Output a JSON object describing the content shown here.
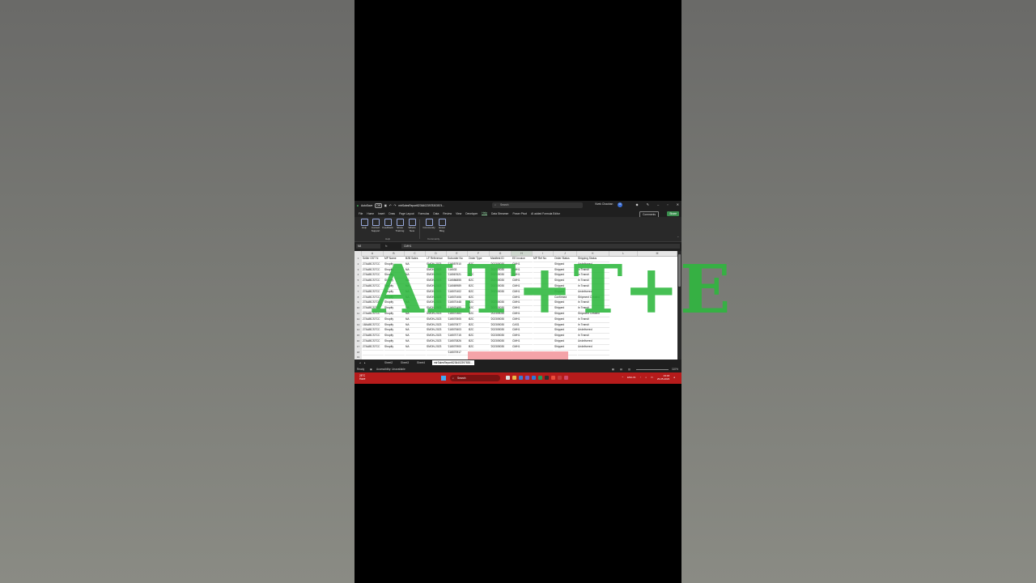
{
  "titlebar": {
    "autosave_label": "AutoSave",
    "autosave_state": "Off",
    "filename": "mtrSalesReport82364023978303574...",
    "search_placeholder": "Search",
    "user_name": "Vivek Chauhan",
    "user_initials": "VC"
  },
  "menu": {
    "items": [
      "File",
      "Home",
      "Insert",
      "Draw",
      "Page Layout",
      "Formulas",
      "Data",
      "Review",
      "View",
      "Developer",
      "Help",
      "Data Streamer",
      "Power Pivot",
      "AI added Formula Editor"
    ],
    "active": "Help",
    "comments_label": "Comments",
    "share_label": "Share"
  },
  "ribbon": {
    "buttons": [
      {
        "label": "Help",
        "icon": "help-icon"
      },
      {
        "label": "Contact Support",
        "icon": "support-icon"
      },
      {
        "label": "Feedback",
        "icon": "feedback-icon"
      },
      {
        "label": "Show Training",
        "icon": "training-icon"
      },
      {
        "label": "What's New",
        "icon": "whats-new-icon"
      },
      {
        "label": "Community",
        "icon": "community-icon"
      },
      {
        "label": "Excel Blog",
        "icon": "blog-icon"
      }
    ],
    "groups": [
      "Help",
      "Community"
    ]
  },
  "formula_bar": {
    "name_box": "N8",
    "fx": "fx",
    "content": "CMH1"
  },
  "sheet": {
    "columns": [
      "A",
      "B",
      "C",
      "D",
      "E",
      "F",
      "G",
      "H",
      "I",
      "J",
      "K",
      "L",
      "M"
    ],
    "rows": [
      "1",
      "2",
      "3",
      "4",
      "5",
      "6",
      "7",
      "8",
      "9",
      "10",
      "11",
      "12",
      "13",
      "14",
      "15",
      "16",
      "17",
      "18",
      "19"
    ],
    "headers": [
      "Seller GST N",
      "MP Name",
      "B2B Sales",
      "LF Reference",
      "Suborder No",
      "Order Type",
      "Manifest ID",
      "EE Invoice",
      "MP Ref No",
      "Order Status",
      "Shipping Status"
    ],
    "data": [
      [
        "27AABCS7CC",
        "Shopify",
        "NA",
        "SMON-2023",
        "'116557910",
        "B2C",
        "'202305030",
        "CMH1",
        "",
        "Shipped",
        "Undelivered"
      ],
      [
        "27AABCS7CC",
        "Shopify",
        "NA",
        "SMON-2023",
        "'116533",
        "",
        "'202305030",
        "CMH1",
        "",
        "Shipped",
        "In Transit"
      ],
      [
        "27AABCS7CC",
        "Shopify",
        "NA",
        "SMON-2023",
        "'116567621",
        "B2C",
        "'202305030",
        "CMH1",
        "",
        "Shipped",
        "In Transit"
      ],
      [
        "27AABCS7CC",
        "Shopify",
        "NA",
        "SMON-2023",
        "'116586855",
        "B2C",
        "'202305030",
        "CMH1",
        "",
        "Shipped",
        "In Transit"
      ],
      [
        "27AABCS7CC",
        "Shopify",
        "NA",
        "SMON-2023",
        "'116569989",
        "B2C",
        "'202305030",
        "CMH1",
        "",
        "Shipped",
        "In Transit"
      ],
      [
        "27AABCS7CC",
        "Shopify",
        "NA",
        "SMON-2023",
        "'116570402",
        "B2C",
        "'202305030",
        "CMH1",
        "",
        "Shipped",
        "Undelivered"
      ],
      [
        "27AABCS7CC",
        "Shopify",
        "NA",
        "SMON-2023",
        "'116570406",
        "B2C",
        "",
        "CMH1",
        "",
        "Confirmed",
        "Shipment Created"
      ],
      [
        "27AABCS7CC",
        "Shopify",
        "NA",
        "SMON-2023",
        "'116570448",
        "B2C",
        "'202305030",
        "CMH1",
        "",
        "Shipped",
        "In Transit"
      ],
      [
        "27AABCS7CC",
        "Shopify",
        "NA",
        "SMON-2023",
        "'116570455",
        "B2C",
        "'202305030",
        "CMH1",
        "",
        "Shipped",
        "In Transit"
      ],
      [
        "27AABCS7CC",
        "Shopify",
        "NA",
        "SMON-2023",
        "'116570483",
        "B2C",
        "'202305030",
        "CMH1",
        "",
        "Shipped",
        "Shipment Created"
      ],
      [
        "27AABCS7CC",
        "Shopify",
        "NA",
        "SMON-2023",
        "'116570505",
        "B2C",
        "'202305030",
        "CMH1",
        "",
        "Shipped",
        "In Transit"
      ],
      [
        "18AABCS7CC",
        "Shopify",
        "NA",
        "SMON-2023",
        "'116570577",
        "B2C",
        "'202305030",
        "CAS1",
        "",
        "Shipped",
        "In Transit"
      ],
      [
        "27AABCS7CC",
        "Shopify",
        "NA",
        "SMON-2023",
        "'116570603",
        "B2C",
        "'202305030",
        "CMH1",
        "",
        "Shipped",
        "Undelivered"
      ],
      [
        "27AABCS7CC",
        "Shopify",
        "NA",
        "SMON-2023",
        "'116570715",
        "B2C",
        "'202305030",
        "CMH1",
        "",
        "Shipped",
        "In Transit"
      ],
      [
        "27AABCS7CC",
        "Shopify",
        "NA",
        "SMON-2023",
        "'116570826",
        "B2C",
        "'202305030",
        "CMH1",
        "",
        "Shipped",
        "Undelivered"
      ],
      [
        "27AABCS7CC",
        "Shopify",
        "NA",
        "SMON-2023",
        "'116570900",
        "B2C",
        "'202305030",
        "CMH1",
        "",
        "Shipped",
        "Undelivered"
      ],
      [
        "",
        "",
        "",
        "",
        "'116570917",
        "",
        "",
        "",
        "",
        "",
        ""
      ]
    ]
  },
  "sheet_tabs": {
    "tabs": [
      "Sheet2",
      "Sheet3",
      "Sheet4",
      "mtrSalesReport8236402397830..."
    ],
    "active": "mtrSalesReport8236402397830..."
  },
  "status": {
    "ready": "Ready",
    "accessibility": "Accessibility: Unavailable",
    "zoom": "110%"
  },
  "taskbar": {
    "weather_temp": "28°C",
    "weather_desc": "Haze",
    "search_label": "Search",
    "lang": "ENG IN",
    "time": "23:18",
    "date": "25-05-2023"
  },
  "overlay": {
    "shortcut": "ALT+T+E"
  },
  "colors": {
    "overlay_green": "#2db83d",
    "share_green": "#3b8f4f",
    "taskbar_red": "#b61b1b"
  }
}
